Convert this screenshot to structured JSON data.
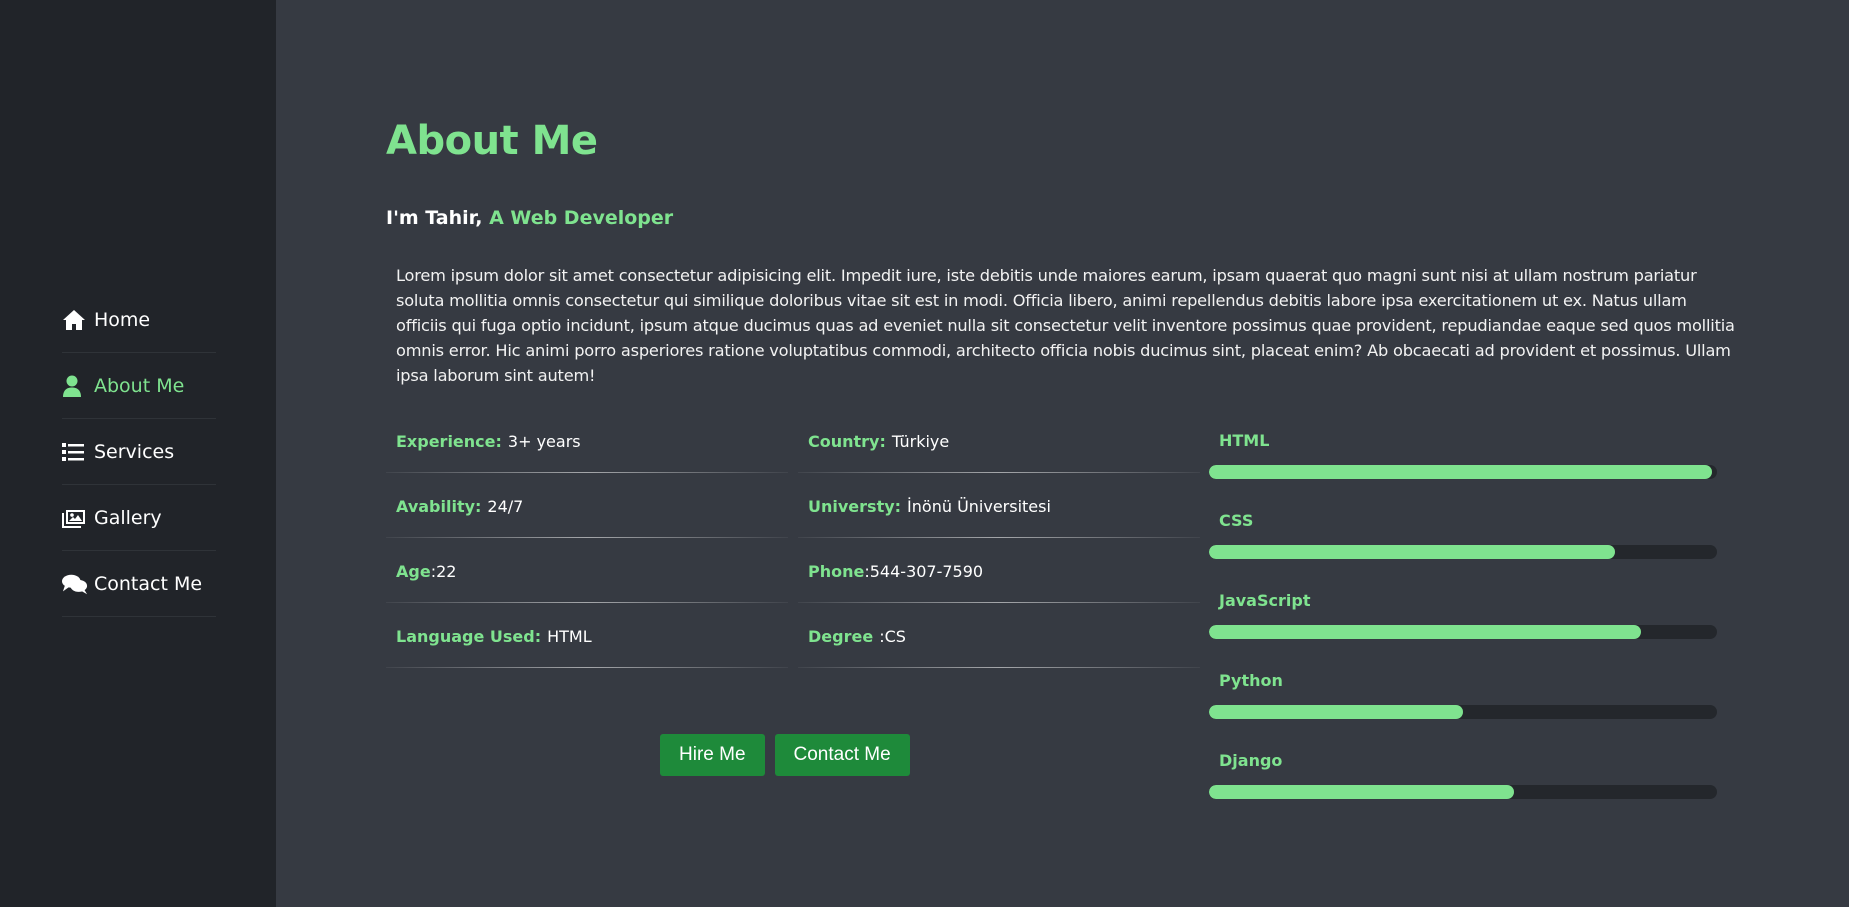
{
  "colors": {
    "accent": "#7fe38f",
    "sidebar_bg": "#212429",
    "main_bg": "#363a42",
    "button_bg": "#1e8a3a"
  },
  "nav": {
    "items": [
      {
        "label": "Home",
        "icon": "home-icon"
      },
      {
        "label": "About Me",
        "icon": "user-icon",
        "active": true
      },
      {
        "label": "Services",
        "icon": "list-icon"
      },
      {
        "label": "Gallery",
        "icon": "images-icon"
      },
      {
        "label": "Contact Me",
        "icon": "comments-icon"
      }
    ]
  },
  "about": {
    "title": "About Me",
    "intro_prefix": "I'm Tahir,",
    "intro_role": "A Web Developer",
    "bio": "Lorem ipsum dolor sit amet consectetur adipisicing elit. Impedit iure, iste debitis unde maiores earum, ipsam quaerat quo magni sunt nisi at ullam nostrum pariatur soluta mollitia omnis consectetur qui similique doloribus vitae sit est in modi. Officia libero, animi repellendus debitis labore ipsa exercitationem ut ex. Natus ullam officiis qui fuga optio incidunt, ipsum atque ducimus quas ad eveniet nulla sit consectetur velit inventore possimus quae provident, repudiandae eaque sed quos mollitia omnis error. Hic animi porro asperiores ratione voluptatibus commodi, architecto officia nobis ducimus sint, placeat enim? Ab obcaecati ad provident et possimus. Ullam ipsa laborum sint autem!"
  },
  "info": [
    {
      "key": "Experience:",
      "value": "3+ years"
    },
    {
      "key": "Country:",
      "value": "Türkiye"
    },
    {
      "key": "Avability:",
      "value": "24/7"
    },
    {
      "key": "Universty:",
      "value": "İnönü Üniversitesi"
    },
    {
      "key": "Age",
      "value": ":22"
    },
    {
      "key": "Phone",
      "value": ":544-307-7590"
    },
    {
      "key": "Language Used:",
      "value": "HTML"
    },
    {
      "key": "Degree",
      "value": ":CS"
    }
  ],
  "buttons": {
    "hire": "Hire Me",
    "contact": "Contact Me"
  },
  "skills": [
    {
      "name": "HTML",
      "level": 0.99
    },
    {
      "name": "CSS",
      "level": 0.8
    },
    {
      "name": "JavaScript",
      "level": 0.85
    },
    {
      "name": "Python",
      "level": 0.5
    },
    {
      "name": "Django",
      "level": 0.6
    }
  ]
}
